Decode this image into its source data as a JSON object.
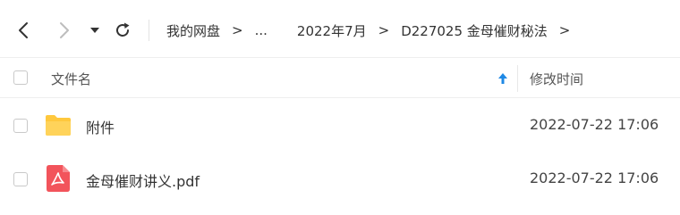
{
  "toolbar": {
    "back_icon": "chevron-left-icon",
    "forward_icon": "chevron-right-icon",
    "dropdown_icon": "caret-down-icon",
    "refresh_icon": "refresh-icon",
    "breadcrumb": [
      "我的网盘",
      "...",
      "2022年7月",
      "D227025 金母催财秘法"
    ],
    "separator": ">"
  },
  "table": {
    "columns": {
      "name": "文件名",
      "modified": "修改时间"
    },
    "sort_icon": "arrow-up-icon",
    "rows": [
      {
        "name": "附件",
        "modified": "2022-07-22 17:06",
        "icon": "folder-icon"
      },
      {
        "name": "金母催财讲义.pdf",
        "modified": "2022-07-22 17:06",
        "icon": "pdf-icon"
      }
    ]
  },
  "colors": {
    "folder": "#FFC83D",
    "pdf": "#F2545B",
    "sort_arrow": "#1E88E5",
    "forward_disabled": "#BDBDBD"
  }
}
